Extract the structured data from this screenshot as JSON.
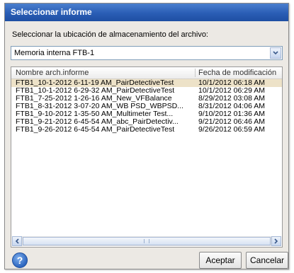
{
  "dialog": {
    "title": "Seleccionar informe",
    "prompt": "Seleccionar la ubicación de almacenamiento del archivo:",
    "location": {
      "selected": "Memoria interna FTB-1"
    },
    "list": {
      "columns": [
        "Nombre arch.informe",
        "Fecha de modificación"
      ],
      "rows": [
        {
          "name": "FTB1_10-1-2012 6-11-19 AM_PairDetectiveTest",
          "date": "10/1/2012 06:18 AM",
          "selected": true
        },
        {
          "name": "FTB1_10-1-2012 6-29-32 AM_PairDetectiveTest",
          "date": "10/1/2012 06:29 AM",
          "selected": false
        },
        {
          "name": "FTB1_7-25-2012 1-26-16 AM_New_VFBalance",
          "date": "8/29/2012 03:08 AM",
          "selected": false
        },
        {
          "name": "FTB1_8-31-2012 3-07-20 AM_WB PSD_WBPSD...",
          "date": "8/31/2012 04:06 AM",
          "selected": false
        },
        {
          "name": "FTB1_9-10-2012 1-35-50 AM_Multimeter Test...",
          "date": "9/10/2012 01:36 AM",
          "selected": false
        },
        {
          "name": "FTB1_9-21-2012 6-45-54 AM_abc_PairDetectiv...",
          "date": "9/21/2012 06:46 AM",
          "selected": false
        },
        {
          "name": "FTB1_9-26-2012 6-45-54 AM_PairDetectiveTest",
          "date": "9/26/2012 06:59 AM",
          "selected": false
        }
      ]
    },
    "buttons": {
      "help": "?",
      "accept": "Aceptar",
      "cancel": "Cancelar"
    }
  },
  "icons": {
    "combo_arrow": "chevron-down-icon",
    "scroll_left": "chevron-left-icon",
    "scroll_right": "chevron-right-icon",
    "help": "help-icon"
  },
  "colors": {
    "titlebar": "#2a5db5",
    "selected_row": "#ede2c8",
    "dialog_bg": "#ece9e4"
  }
}
